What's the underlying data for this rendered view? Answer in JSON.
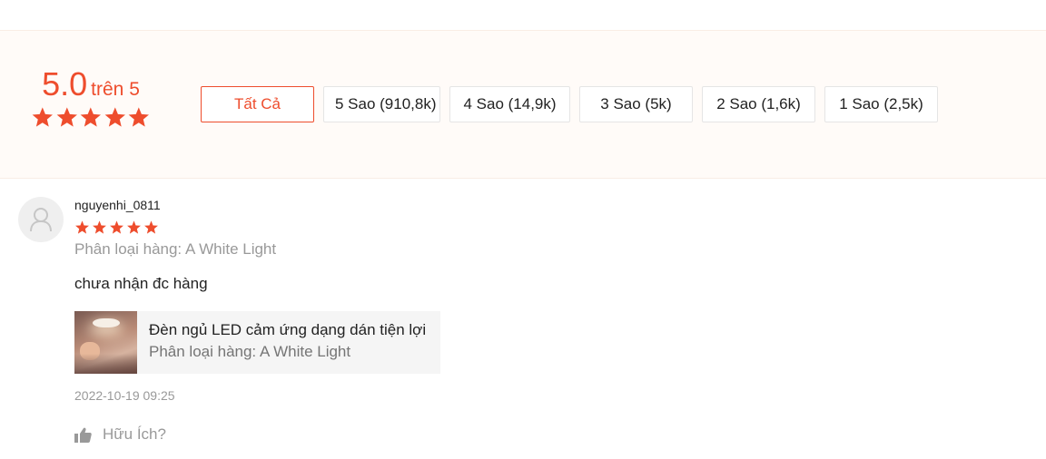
{
  "rating_summary": {
    "score": "5.0",
    "score_suffix": "trên 5",
    "stars": 5,
    "accent_color": "#ee4d2d"
  },
  "filters": [
    {
      "label": "Tất Cả",
      "active": true
    },
    {
      "label": "5 Sao (910,8k)",
      "active": false
    },
    {
      "label": "4 Sao (14,9k)",
      "active": false
    },
    {
      "label": "3 Sao (5k)",
      "active": false
    },
    {
      "label": "2 Sao (1,6k)",
      "active": false
    },
    {
      "label": "1 Sao (2,5k)",
      "active": false
    }
  ],
  "review": {
    "avatar_icon": "user-icon",
    "username": "nguyenhi_0811",
    "stars": 5,
    "variation": "Phân loại hàng: A White Light",
    "comment": "chưa nhận đc hàng",
    "product": {
      "name": "Đèn ngủ LED cảm ứng dạng dán tiện lợi",
      "variation": "Phân loại hàng: A White Light"
    },
    "timestamp": "2022-10-19 09:25",
    "helpful_icon": "thumbs-up-icon",
    "helpful_label": "Hữu Ích?"
  }
}
